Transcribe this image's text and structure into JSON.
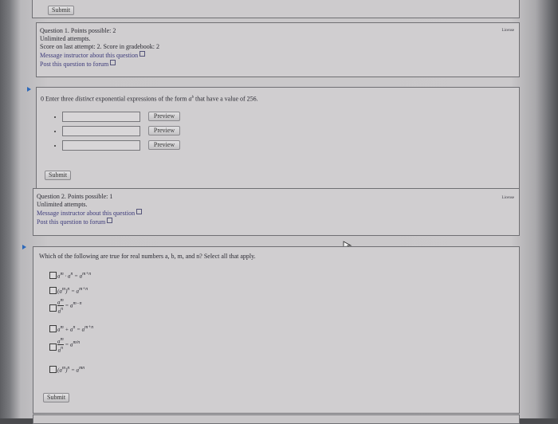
{
  "top_submit_label": "Submit",
  "q1": {
    "license_label": "License",
    "points_line": "Question 1. Points possible: 2",
    "attempts_line": "Unlimited attempts.",
    "score_line": "Score on last attempt: 2. Score in gradebook: 2",
    "message_link": "Message instructor about this question",
    "forum_link": "Post this question to forum",
    "prompt_prefix": "0 Enter three ",
    "prompt_emph": "distinct",
    "prompt_mid": " exponential expressions of the form ",
    "prompt_var": "a",
    "prompt_sup": "b",
    "prompt_suffix": " that have a value of 256.",
    "preview_label": "Preview",
    "submit_label": "Submit"
  },
  "q2": {
    "license_label": "License",
    "points_line": "Question 2. Points possible: 1",
    "attempts_line": "Unlimited attempts.",
    "message_link": "Message instructor about this question",
    "forum_link": "Post this question to forum",
    "prompt": "Which of the following are true for real numbers a, b, m, and n? Select all that apply.",
    "submit_label": "Submit"
  },
  "icons": [
    "external-link-icon",
    "play-arrow-icon",
    "cursor-icon"
  ]
}
